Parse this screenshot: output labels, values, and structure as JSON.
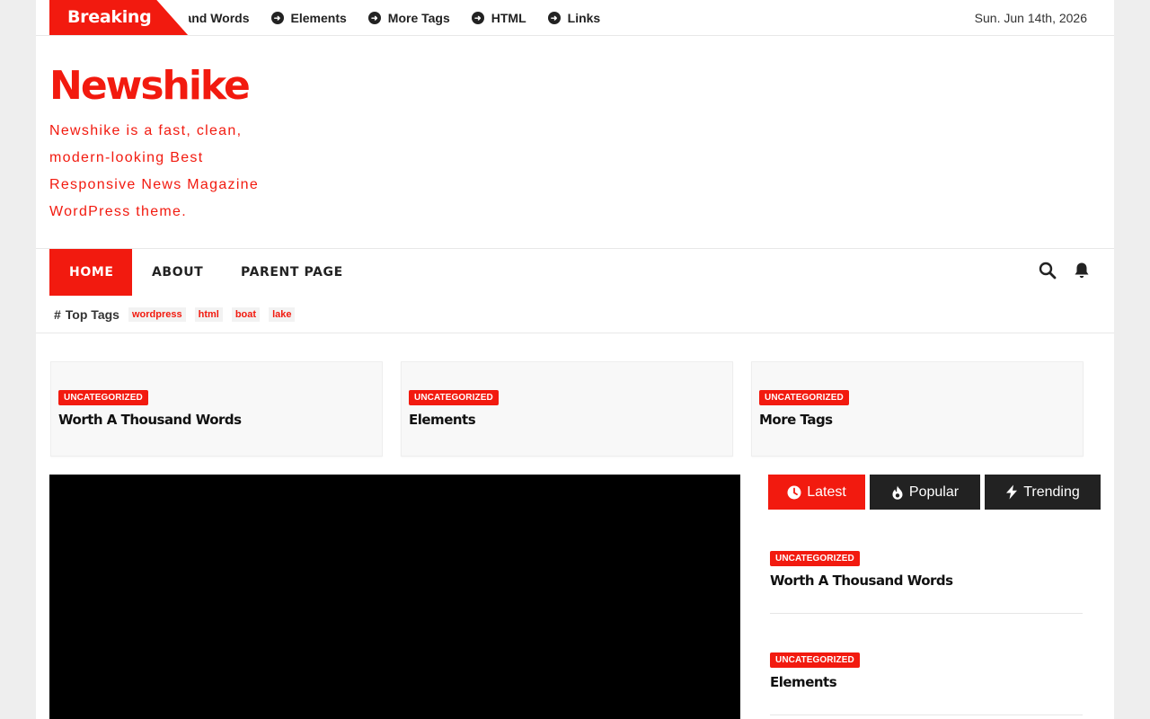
{
  "topbar": {
    "breaking_label": "Breaking",
    "ticker": [
      "housand Words",
      "Elements",
      "More Tags",
      "HTML",
      "Links"
    ],
    "date": "Sun. Jun 14th, 2026"
  },
  "site": {
    "title": "Newshike",
    "description": "Newshike is a fast, clean, modern-looking Best Responsive News Magazine WordPress theme."
  },
  "nav": {
    "items": [
      {
        "label": "HOME"
      },
      {
        "label": "ABOUT"
      },
      {
        "label": "PARENT PAGE"
      }
    ],
    "icons": [
      "search-icon",
      "bell-icon"
    ]
  },
  "top_tags": {
    "label": "Top Tags",
    "tags": [
      "wordpress",
      "html",
      "boat",
      "lake"
    ]
  },
  "featured": [
    {
      "category": "UNCATEGORIZED",
      "title": "Worth A Thousand Words"
    },
    {
      "category": "UNCATEGORIZED",
      "title": "Elements"
    },
    {
      "category": "UNCATEGORIZED",
      "title": "More Tags"
    }
  ],
  "tabs": [
    {
      "label": "Latest",
      "icon": "clock-icon"
    },
    {
      "label": "Popular",
      "icon": "fire-icon"
    },
    {
      "label": "Trending",
      "icon": "bolt-icon"
    }
  ],
  "latest_posts": [
    {
      "category": "UNCATEGORIZED",
      "title": "Worth A Thousand Words"
    },
    {
      "category": "UNCATEGORIZED",
      "title": "Elements"
    }
  ],
  "colors": {
    "accent": "#f21a0f",
    "dark": "#222222"
  }
}
